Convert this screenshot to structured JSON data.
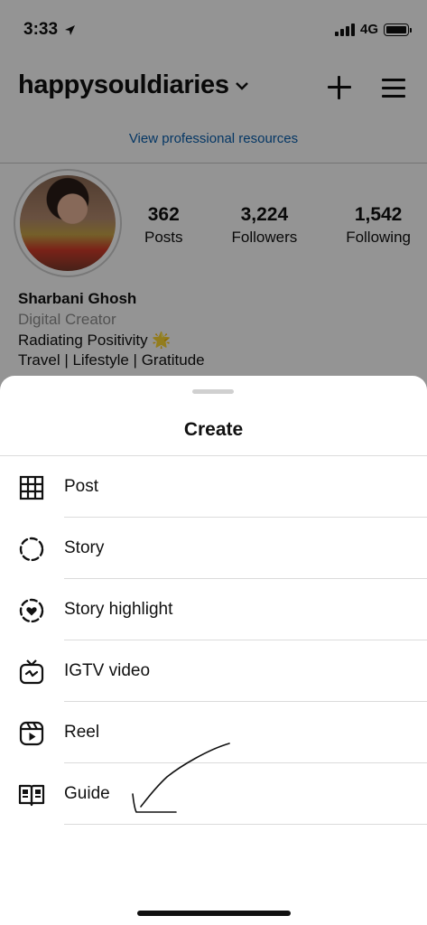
{
  "status_bar": {
    "time": "3:33",
    "network": "4G"
  },
  "header": {
    "username": "happysouldiaries"
  },
  "professional_link": "View professional resources",
  "stats": [
    {
      "value": "362",
      "label": "Posts"
    },
    {
      "value": "3,224",
      "label": "Followers"
    },
    {
      "value": "1,542",
      "label": "Following"
    }
  ],
  "bio": {
    "name": "Sharbani Ghosh",
    "category": "Digital Creator",
    "line1": "Radiating Positivity 🌟",
    "line2": "Travel | Lifestyle | Gratitude"
  },
  "sheet": {
    "title": "Create",
    "items": [
      {
        "label": "Post",
        "icon": "grid-icon"
      },
      {
        "label": "Story",
        "icon": "story-dashed-circle-icon"
      },
      {
        "label": "Story highlight",
        "icon": "story-highlight-heart-icon"
      },
      {
        "label": "IGTV video",
        "icon": "igtv-icon"
      },
      {
        "label": "Reel",
        "icon": "reel-icon"
      },
      {
        "label": "Guide",
        "icon": "guide-book-icon"
      }
    ]
  },
  "colors": {
    "link": "#0a5fae",
    "overlay": "rgba(0,0,0,0.42)",
    "text": "#111111"
  }
}
